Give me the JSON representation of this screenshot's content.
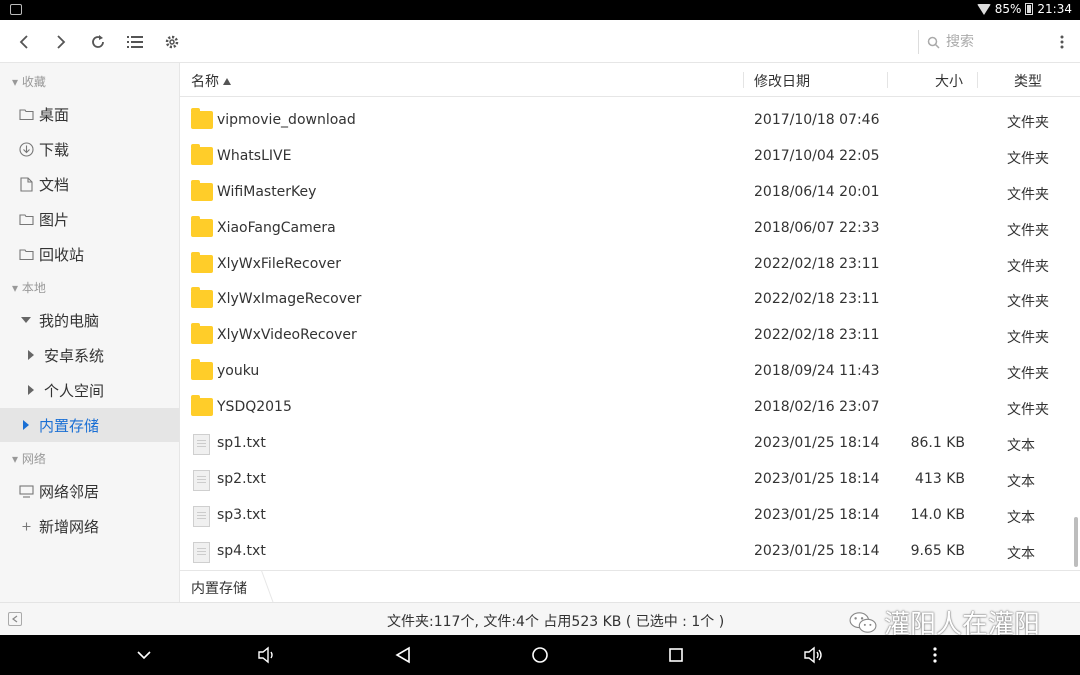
{
  "status_bar": {
    "battery": "85%",
    "time": "21:34"
  },
  "toolbar": {
    "search_placeholder": "搜索"
  },
  "sidebar": {
    "sections": [
      "收藏",
      "本地",
      "网络"
    ],
    "favorites": [
      {
        "label": "桌面",
        "icon": "folder-outline-icon"
      },
      {
        "label": "下载",
        "icon": "download-icon"
      },
      {
        "label": "文档",
        "icon": "document-icon"
      },
      {
        "label": "图片",
        "icon": "image-icon"
      },
      {
        "label": "回收站",
        "icon": "trash-icon"
      }
    ],
    "local": {
      "root": "我的电脑",
      "children": [
        "安卓系统",
        "个人空间",
        "内置存储"
      ],
      "selected": "内置存储"
    },
    "network": [
      {
        "label": "网络邻居",
        "icon": "network-icon"
      },
      {
        "label": "新增网络",
        "icon": "plus-icon"
      }
    ]
  },
  "columns": {
    "name": "名称",
    "date": "修改日期",
    "size": "大小",
    "type": "类型"
  },
  "files": [
    {
      "name": "vipmovie_download",
      "date": "2017/10/18 07:46",
      "size": "",
      "type": "文件夹",
      "kind": "folder"
    },
    {
      "name": "WhatsLIVE",
      "date": "2017/10/04 22:05",
      "size": "",
      "type": "文件夹",
      "kind": "folder"
    },
    {
      "name": "WifiMasterKey",
      "date": "2018/06/14 20:01",
      "size": "",
      "type": "文件夹",
      "kind": "folder"
    },
    {
      "name": "XiaoFangCamera",
      "date": "2018/06/07 22:33",
      "size": "",
      "type": "文件夹",
      "kind": "folder"
    },
    {
      "name": "XlyWxFileRecover",
      "date": "2022/02/18 23:11",
      "size": "",
      "type": "文件夹",
      "kind": "folder"
    },
    {
      "name": "XlyWxImageRecover",
      "date": "2022/02/18 23:11",
      "size": "",
      "type": "文件夹",
      "kind": "folder"
    },
    {
      "name": "XlyWxVideoRecover",
      "date": "2022/02/18 23:11",
      "size": "",
      "type": "文件夹",
      "kind": "folder"
    },
    {
      "name": "youku",
      "date": "2018/09/24 11:43",
      "size": "",
      "type": "文件夹",
      "kind": "folder"
    },
    {
      "name": "YSDQ2015",
      "date": "2018/02/16 23:07",
      "size": "",
      "type": "文件夹",
      "kind": "folder"
    },
    {
      "name": "sp1.txt",
      "date": "2023/01/25 18:14",
      "size": "86.1 KB",
      "type": "文本",
      "kind": "text"
    },
    {
      "name": "sp2.txt",
      "date": "2023/01/25 18:14",
      "size": "413 KB",
      "type": "文本",
      "kind": "text"
    },
    {
      "name": "sp3.txt",
      "date": "2023/01/25 18:14",
      "size": "14.0 KB",
      "type": "文本",
      "kind": "text"
    },
    {
      "name": "sp4.txt",
      "date": "2023/01/25 18:14",
      "size": "9.65 KB",
      "type": "文本",
      "kind": "text"
    }
  ],
  "path": "内置存储",
  "status_text": "文件夹:117个, 文件:4个 占用523 KB ( 已选中 : 1个 )",
  "watermark": "灌阳人在灌阳",
  "colors": {
    "accent": "#1a6fd4",
    "folder": "#ffcd29"
  }
}
